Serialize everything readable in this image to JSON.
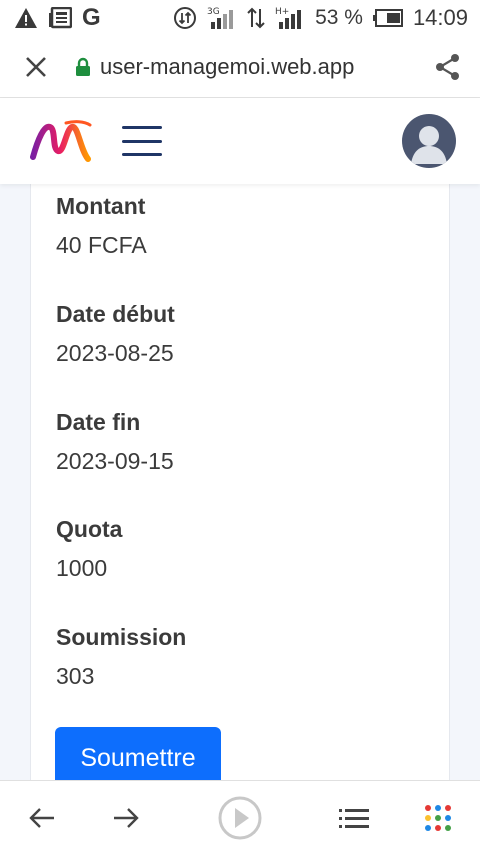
{
  "status_bar": {
    "battery": "53 %",
    "time": "14:09",
    "network_3g": "3G",
    "network_h": "H+",
    "google_letter": "G",
    "icons": [
      "warning-icon",
      "news-icon",
      "google-icon",
      "data-saver-icon",
      "signal-3g-icon",
      "data-transfer-icon",
      "signal-h-icon",
      "battery-icon"
    ]
  },
  "browser": {
    "url": "user-managemoi.web.app",
    "lock_color": "#1e8e3e",
    "icons": [
      "close-icon",
      "lock-icon",
      "share-icon"
    ]
  },
  "header": {
    "logo_colors": [
      "#e91e63",
      "#7b1fa2",
      "#ff9800"
    ],
    "menu_color": "#1f3566",
    "icons": [
      "logo-icon",
      "hamburger-menu-icon",
      "user-avatar-icon"
    ]
  },
  "details": {
    "fields": [
      {
        "label": "Montant",
        "value": "40 FCFA"
      },
      {
        "label": "Date début",
        "value": "2023-08-25"
      },
      {
        "label": "Date fin",
        "value": "2023-09-15"
      },
      {
        "label": "Quota",
        "value": "1000"
      },
      {
        "label": "Soumission",
        "value": "303"
      }
    ],
    "submit_label": "Soumettre",
    "button_color": "#0d6efd"
  },
  "bottom_nav": {
    "icons": [
      "back-arrow-icon",
      "forward-arrow-icon",
      "play-icon",
      "list-icon",
      "apps-grid-icon"
    ]
  }
}
